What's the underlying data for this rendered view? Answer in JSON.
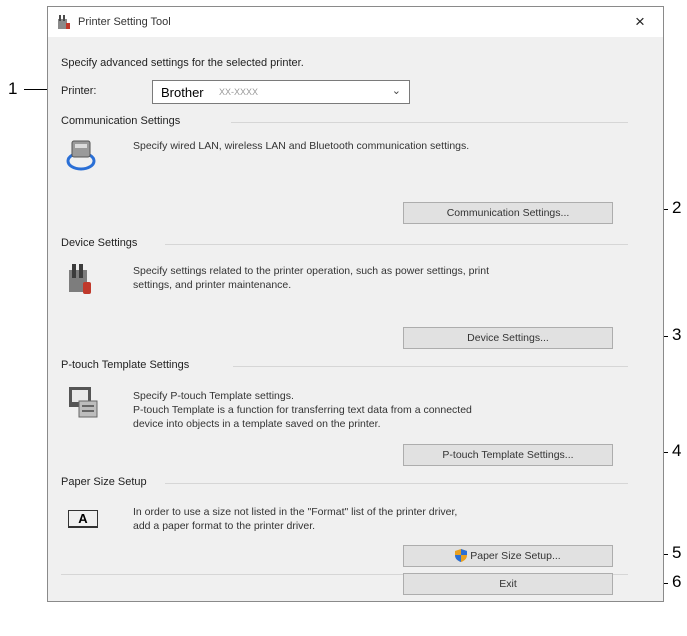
{
  "callouts": [
    "1",
    "2",
    "3",
    "4",
    "5",
    "6"
  ],
  "window": {
    "title": "Printer Setting Tool",
    "close_glyph": "×",
    "intro": "Specify advanced settings for the selected printer.",
    "printer_label": "Printer:",
    "printer_value": "Brother",
    "printer_model": "XX-XXXX"
  },
  "sections": {
    "communication": {
      "heading": "Communication Settings",
      "desc": "Specify wired LAN, wireless LAN and Bluetooth communication settings.",
      "button": "Communication Settings..."
    },
    "device": {
      "heading": "Device Settings",
      "desc_line1": "Specify settings related to the printer operation, such as power settings, print",
      "desc_line2": "settings, and printer maintenance.",
      "button": "Device Settings..."
    },
    "template": {
      "heading": "P-touch Template Settings",
      "desc_line1": "Specify P-touch Template settings.",
      "desc_line2": "P-touch Template is a function for transferring text data from a connected",
      "desc_line3": "device into objects in a template saved on the printer.",
      "button": "P-touch Template Settings..."
    },
    "paper": {
      "heading": "Paper Size Setup",
      "desc_line1": "In order to use a size not listed in the \"Format\" list of the printer driver,",
      "desc_line2": "add a paper format to the printer driver.",
      "button": "Paper Size Setup...",
      "icon_glyph": "A"
    }
  },
  "exit_button": "Exit"
}
